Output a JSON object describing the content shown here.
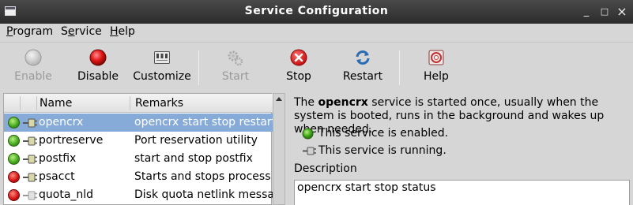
{
  "window": {
    "title": "Service Configuration",
    "controls": {
      "minimize": "_",
      "maximize": "□",
      "close": "×"
    }
  },
  "menu": [
    {
      "label": "Program",
      "mnemonic_index": 0
    },
    {
      "label": "Service",
      "mnemonic_index": 1
    },
    {
      "label": "Help",
      "mnemonic_index": 0
    }
  ],
  "toolbar": {
    "enable": {
      "label": "Enable",
      "icon": "enable-icon",
      "enabled": false
    },
    "disable": {
      "label": "Disable",
      "icon": "disable-icon",
      "enabled": true
    },
    "customize": {
      "label": "Customize",
      "icon": "customize-icon",
      "enabled": true
    },
    "start": {
      "label": "Start",
      "icon": "start-gear-icon",
      "enabled": false
    },
    "stop": {
      "label": "Stop",
      "icon": "stop-icon",
      "enabled": true
    },
    "restart": {
      "label": "Restart",
      "icon": "restart-icon",
      "enabled": true
    },
    "help": {
      "label": "Help",
      "icon": "help-icon",
      "enabled": true
    }
  },
  "list": {
    "columns": [
      "Name",
      "Remarks"
    ],
    "rows": [
      {
        "name": "opencrx",
        "remarks": "opencrx start stop restart s",
        "enabled": true,
        "running": true,
        "selected": true
      },
      {
        "name": "portreserve",
        "remarks": "Port reservation utility",
        "enabled": true,
        "running": true,
        "selected": false
      },
      {
        "name": "postfix",
        "remarks": "start and stop postfix",
        "enabled": true,
        "running": true,
        "selected": false
      },
      {
        "name": "psacct",
        "remarks": "Starts and stops process ac",
        "enabled": false,
        "running": true,
        "selected": false
      },
      {
        "name": "quota_nld",
        "remarks": "Disk quota netlink messag",
        "enabled": false,
        "running": false,
        "selected": false
      }
    ]
  },
  "detail": {
    "intro_pre": "The ",
    "service_name": "opencrx",
    "intro_post": " service is started once, usually when the system is booted, runs in the background and wakes up when needed.",
    "enabled_text": "This service is enabled.",
    "running_text": "This service is running.",
    "description_label": "Description",
    "description_text": "opencrx start stop status"
  },
  "colors": {
    "selection": "#86abd9",
    "enabled_green": "#3fa51a",
    "disabled_red": "#d41010"
  }
}
